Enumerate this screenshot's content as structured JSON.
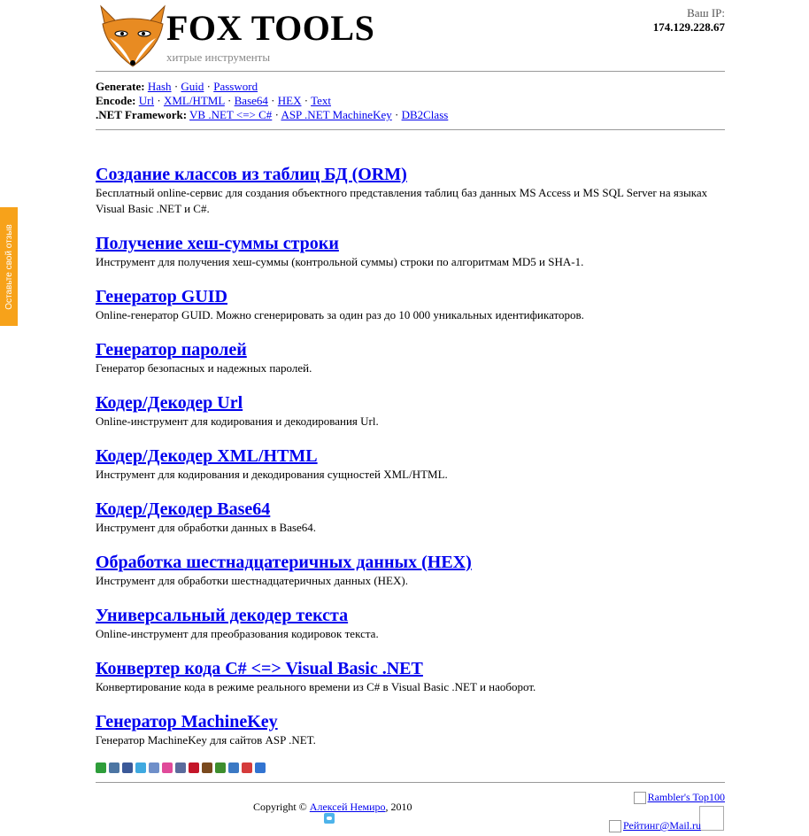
{
  "feedback_tab": {
    "label": "Оставьте свой отзыв"
  },
  "header": {
    "title": "FOX TOOLS",
    "tagline": "хитрые инструменты",
    "ip_label": "Ваш IP:",
    "ip_value": "174.129.228.67"
  },
  "nav": {
    "generate": {
      "label": "Generate:",
      "links": [
        "Hash",
        "Guid",
        "Password"
      ]
    },
    "encode": {
      "label": "Encode:",
      "links": [
        "Url",
        "XML/HTML",
        "Base64",
        "HEX",
        "Text"
      ]
    },
    "dotnet": {
      "label": ".NET Framework:",
      "links": [
        "VB .NET <=> C#",
        "ASP .NET MachineKey",
        "DB2Class"
      ]
    }
  },
  "tools": [
    {
      "title": "Создание классов из таблиц БД (ORM)",
      "desc": "Бесплатный online-сервис для создания объектного представления таблиц баз данных MS Access и MS SQL Server на языках Visual Basic .NET и C#."
    },
    {
      "title": "Получение хеш-суммы строки",
      "desc": "Инструмент для получения хеш-суммы (контрольной суммы) строки по алгоритмам MD5 и SHA-1."
    },
    {
      "title": "Генератор GUID",
      "desc": "Online-генератор GUID. Можно сгенерировать за один раз до 10 000 уникальных идентификаторов."
    },
    {
      "title": "Генератор паролей",
      "desc": "Генератор безопасных и надежных паролей."
    },
    {
      "title": "Кодер/Декодер Url",
      "desc": "Online-инструмент для кодирования и декодирования Url."
    },
    {
      "title": "Кодер/Декодер XML/HTML",
      "desc": "Инструмент для кодирования и декодирования сущностей XML/HTML."
    },
    {
      "title": "Кодер/Декодер Base64",
      "desc": "Инструмент для обработки данных в Base64."
    },
    {
      "title": "Обработка шестнадцатеричных данных (HEX)",
      "desc": "Инструмент для обработки шестнадцатеричных данных (HEX)."
    },
    {
      "title": "Универсальный декодер текста",
      "desc": "Online-инструмент для преобразования кодировок текста."
    },
    {
      "title": "Конвертер кода C# <=> Visual Basic .NET",
      "desc": "Конвертирование кода в режиме реального времени из C# в Visual Basic .NET и наоборот."
    },
    {
      "title": "Генератор MachineKey",
      "desc": "Генератор MachineKey для сайтов ASP .NET."
    }
  ],
  "share_icons": [
    {
      "name": "plus-share-icon",
      "color": "#2e9d3a"
    },
    {
      "name": "vkontakte-icon",
      "color": "#4c75a3"
    },
    {
      "name": "facebook-icon",
      "color": "#3b5998"
    },
    {
      "name": "twitter-icon",
      "color": "#3fa9e0"
    },
    {
      "name": "moikrug-icon",
      "color": "#6f8fc9"
    },
    {
      "name": "flower-icon",
      "color": "#e04a9a"
    },
    {
      "name": "pencil-icon",
      "color": "#5b6b9c"
    },
    {
      "name": "bobrdobr-icon",
      "color": "#c4162a"
    },
    {
      "name": "memori-icon",
      "color": "#7a4a1e"
    },
    {
      "name": "google-icon",
      "color": "#3e8e2e"
    },
    {
      "name": "bookmark-icon",
      "color": "#3b79c4"
    },
    {
      "name": "grid-icon",
      "color": "#d53b3b"
    },
    {
      "name": "delicious-icon",
      "color": "#3274d1"
    }
  ],
  "footer": {
    "copyright_prefix": "Copyright © ",
    "author": "Алексей Немиро",
    "year": ", 2010",
    "rambler": "Rambler's Top100",
    "mailru": "Рейтинг@Mail.ru"
  },
  "colors": {
    "link": "#0000ee",
    "feedback": "#f7a21a",
    "fox_orange": "#e88b22"
  }
}
